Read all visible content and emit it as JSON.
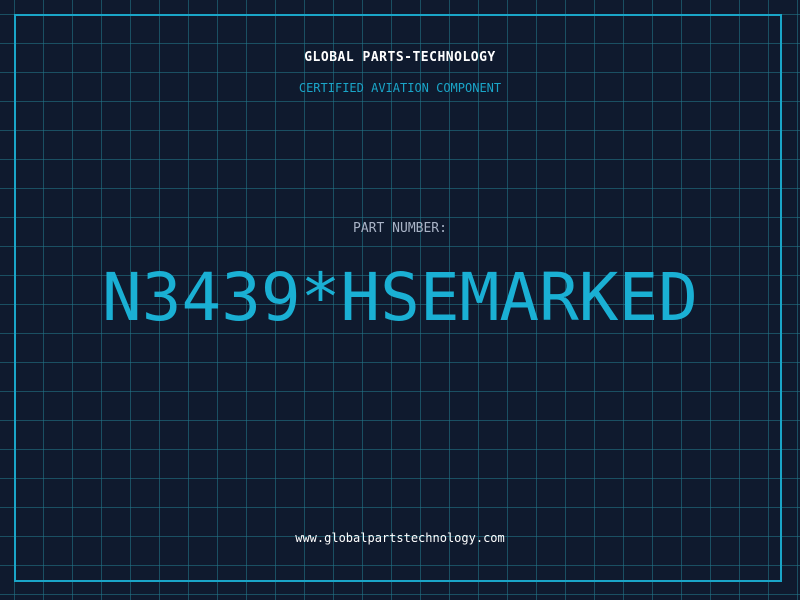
{
  "header": {
    "company": "GLOBAL PARTS-TECHNOLOGY",
    "certification": "CERTIFIED AVIATION COMPONENT"
  },
  "part": {
    "label": "PART NUMBER:",
    "number": "N3439*HSEMARKED"
  },
  "footer": {
    "website": "www.globalpartstechnology.com"
  },
  "colors": {
    "background": "#0f1a2e",
    "accent": "#1ab0d4",
    "grid": "#227a8c",
    "text": "#ffffff",
    "muted": "#a9b3c6"
  }
}
